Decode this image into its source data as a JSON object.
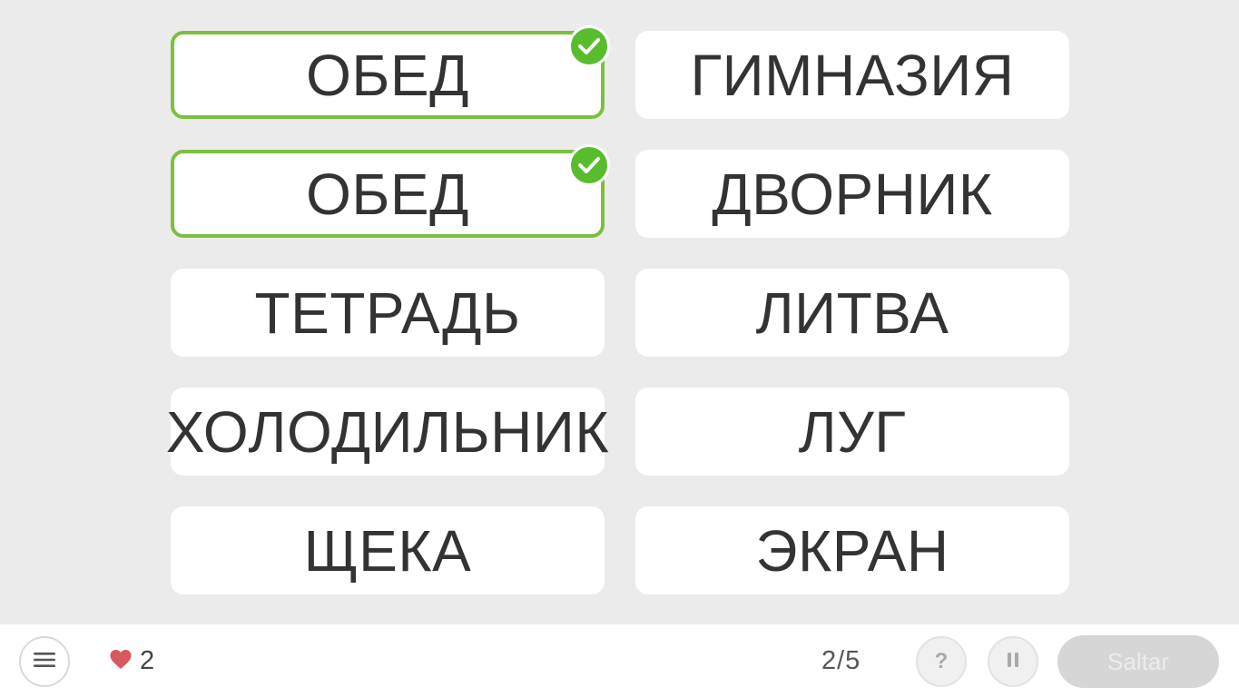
{
  "cards": [
    {
      "label": "ОБЕД",
      "matched": true
    },
    {
      "label": "ГИМНАЗИЯ",
      "matched": false
    },
    {
      "label": "ОБЕД",
      "matched": true
    },
    {
      "label": "ДВОРНИК",
      "matched": false
    },
    {
      "label": "ТЕТРАДЬ",
      "matched": false
    },
    {
      "label": "ЛИТВА",
      "matched": false
    },
    {
      "label": "ХОЛОДИЛЬНИК",
      "matched": false
    },
    {
      "label": "ЛУГ",
      "matched": false
    },
    {
      "label": "ЩЕКА",
      "matched": false
    },
    {
      "label": "ЭКРАН",
      "matched": false
    }
  ],
  "footer": {
    "lives": "2",
    "progress": "2/5",
    "help_label": "?",
    "skip_label": "Saltar"
  },
  "icons": {
    "menu": "menu-icon",
    "heart": "heart-icon",
    "pause": "pause-icon",
    "check": "checkmark-icon"
  },
  "colors": {
    "match_border": "#7cbf3f",
    "check_badge": "#58bd2c",
    "heart": "#d9575f",
    "background": "#ebebeb"
  }
}
